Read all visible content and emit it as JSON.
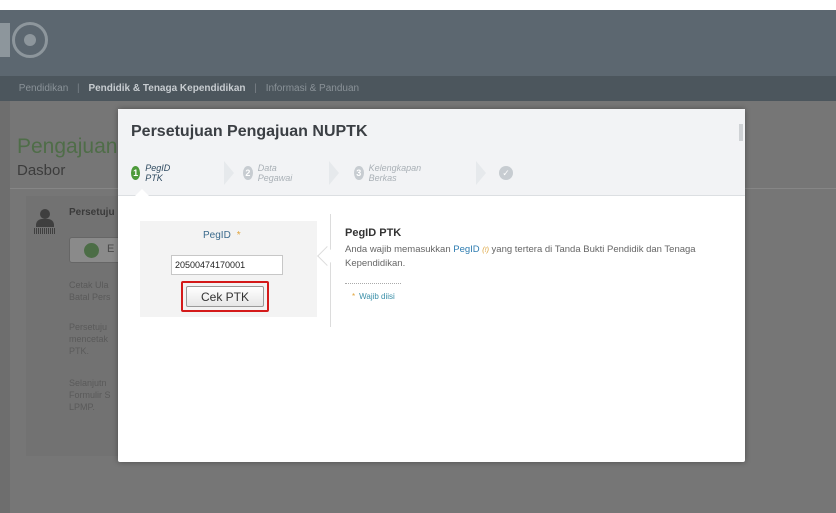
{
  "nav": {
    "items": [
      "Pendidikan",
      "Pendidik & Tenaga Kependidikan",
      "Informasi & Panduan"
    ],
    "active_index": 1,
    "separator": "|"
  },
  "background": {
    "page_title": "Pengajuan",
    "section_title": "Dasbor",
    "panel_heading": "Persetuju",
    "panel_button": "E",
    "text_block_1": [
      "Cetak Ula",
      "Batal Pers"
    ],
    "text_block_2": [
      "Persetuju",
      "mencetak",
      "PTK."
    ],
    "text_block_3": [
      "Selanjutn",
      "Formulir S",
      "LPMP."
    ]
  },
  "modal": {
    "title": "Persetujuan Pengajuan NUPTK",
    "steps": [
      {
        "num": "1",
        "label": "PegID PTK",
        "state": "active"
      },
      {
        "num": "2",
        "label": "Data Pegawai",
        "state": "inactive"
      },
      {
        "num": "3",
        "label": "Kelengkapan Berkas",
        "state": "inactive"
      }
    ],
    "done_icon": "check-icon",
    "form": {
      "label": "PegID",
      "required_mark": "*",
      "value": "20500474170001",
      "button": "Cek PTK"
    },
    "info": {
      "title": "PegID PTK",
      "text_before": "Anda wajib memasukkan",
      "highlight": "PegID",
      "note": "(!)",
      "text_after": "yang tertera di Tanda Bukti Pendidik dan Tenaga Kependidikan.",
      "required_note": "Wajib diisi"
    }
  },
  "colors": {
    "accent_green": "#4d9a3a",
    "highlight_red": "#d41a1a",
    "link_blue": "#2f7db1"
  }
}
